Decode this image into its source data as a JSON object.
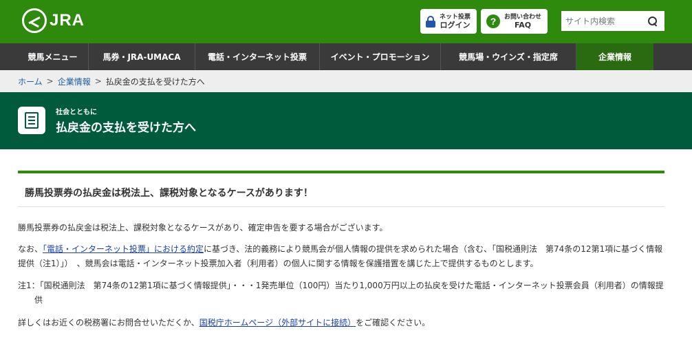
{
  "header": {
    "logo_text": "JRA",
    "login": {
      "small": "ネット投票",
      "large": "ログイン"
    },
    "faq": {
      "small": "お問い合わせ",
      "large": "FAQ"
    },
    "search_placeholder": "サイト内検索"
  },
  "nav": {
    "items": [
      {
        "label": "競馬メニュー"
      },
      {
        "label": "馬券・JRA-UMACA"
      },
      {
        "label": "電話・インターネット投票"
      },
      {
        "label": "イベント・プロモーション"
      },
      {
        "label": "競馬場・ウインズ・指定席"
      },
      {
        "label": "企業情報"
      }
    ]
  },
  "breadcrumb": {
    "home": "ホーム",
    "corporate": "企業情報",
    "current": "払戻金の支払を受けた方へ",
    "separator": ">"
  },
  "page_header": {
    "subtitle": "社会とともに",
    "title": "払戻金の支払を受けた方へ"
  },
  "content": {
    "heading": "勝馬投票券の払戻金は税法上、課税対象となるケースがあります！",
    "p1": "勝馬投票券の払戻金は税法上、課税対象となるケースがあり、確定申告を要する場合がございます。",
    "p2_pre": "なお、",
    "p2_link": "「電話・インターネット投票」における約定",
    "p2_post": "に基づき、法的義務により競馬会が個人情報の提供を求められた場合（含む、「国税通則法　第74条の12第1項に基づく情報提供（注1）」）　、競馬会は電話・インターネット投票加入者（利用者）の個人に関する情報を保護措置を講じた上で提供するものとします。",
    "note": "注1：「国税通則法　第74条の12第1項に基づく情報提供」・・・1発売単位（100円）当たり1,000万円以上の払戻を受けた電話・インターネット投票会員（利用者）の情報提供",
    "p4_pre": "詳しくはお近くの税務署にお問合せいただくか、",
    "p4_link": "国税庁ホームページ（外部サイトに接続）",
    "p4_post": "をご確認ください。"
  },
  "colors": {
    "header_green": "#2e8a0c",
    "nav_bg": "#3a3a3a",
    "nav_active": "#2a6a10",
    "page_header": "#005a3c",
    "link": "#1a40b0"
  }
}
